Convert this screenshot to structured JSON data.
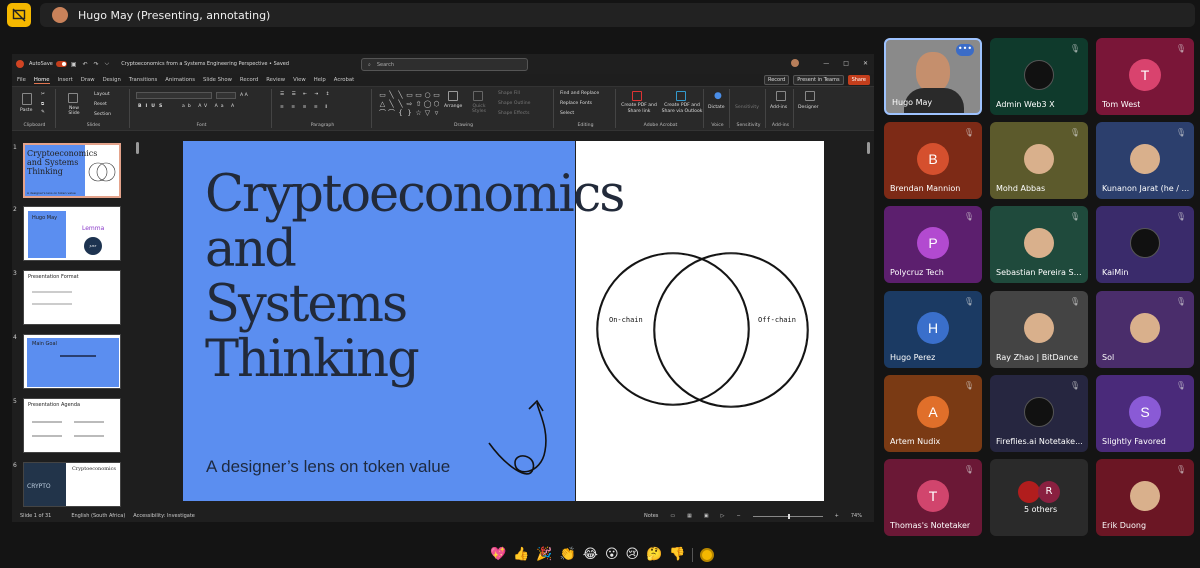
{
  "meeting": {
    "presenter_label": "Hugo May (Presenting, annotating)",
    "reactions": [
      "💖",
      "👍",
      "🎉",
      "👏",
      "😂",
      "😮",
      "😢",
      "🤔",
      "👎"
    ]
  },
  "powerpoint": {
    "autosave": "AutoSave",
    "doc_title": "Cryptoeconomics from a Systems Engineering Perspective • Saved",
    "search_placeholder": "Search",
    "menus": [
      "File",
      "Home",
      "Insert",
      "Draw",
      "Design",
      "Transitions",
      "Animations",
      "Slide Show",
      "Record",
      "Review",
      "View",
      "Help",
      "Acrobat"
    ],
    "active_menu": "Home",
    "record_btn": "Record",
    "present_btn": "Present in Teams",
    "share_btn": "Share",
    "ribbon": {
      "paste": "Paste",
      "new_slide": "New Slide",
      "layout": "Layout",
      "reset": "Reset",
      "section": "Section",
      "arrange": "Arrange",
      "quick_styles": "Quick Styles",
      "shape_fill": "Shape Fill",
      "shape_outline": "Shape Outline",
      "shape_effects": "Shape Effects",
      "find_replace": "Find and Replace",
      "replace_fonts": "Replace Fonts",
      "select": "Select",
      "create_pdf_share": "Create PDF and Share link",
      "create_pdf_outlook": "Create PDF and Share via Outlook",
      "dictate": "Dictate",
      "sensitivity": "Sensitivity",
      "addins": "Add-ins",
      "designer": "Designer",
      "groups": [
        "Clipboard",
        "Slides",
        "Font",
        "Paragraph",
        "Drawing",
        "Editing",
        "Adobe Acrobat",
        "Voice",
        "Sensitivity",
        "Add-ins"
      ]
    },
    "thumbnails": [
      {
        "num": "1",
        "title": "Cryptoeconomics and Systems Thinking",
        "sub": "A designer's lens on token value"
      },
      {
        "num": "2",
        "title": "Hugo May",
        "logo": "Lemma",
        "badge": "JUST"
      },
      {
        "num": "3",
        "title": "Presentation Format"
      },
      {
        "num": "4",
        "title": "Main Goal"
      },
      {
        "num": "5",
        "title": "Presentation Agenda"
      },
      {
        "num": "6",
        "title": "Cryptoeconomics",
        "img": "CRYPTO"
      }
    ],
    "slide": {
      "title": "Cryptoeconomics\nand\nSystems Thinking",
      "subtitle": "A designer’s lens on token value",
      "venn_left": "On-chain",
      "venn_right": "Off-chain"
    },
    "status": {
      "slide_count": "Slide 1 of 31",
      "language": "English (South Africa)",
      "accessibility": "Accessibility: Investigate",
      "notes": "Notes",
      "zoom": "74%"
    }
  },
  "participants": [
    {
      "name": "Hugo May",
      "type": "video",
      "color": "#8a8a8a",
      "col": 0,
      "row": 0,
      "active": true
    },
    {
      "name": "Admin Web3 X",
      "type": "logo",
      "color": "#0f3a2c",
      "col": 1,
      "row": 0
    },
    {
      "name": "Tom West",
      "initial": "T",
      "color": "#7a1638",
      "circle": "#d9436e",
      "col": 2,
      "row": 0
    },
    {
      "name": "Brendan Mannion",
      "initial": "B",
      "color": "#7d2a16",
      "circle": "#d5502e",
      "col": 0,
      "row": 1
    },
    {
      "name": "Mohd Abbas",
      "type": "pic",
      "color": "#5c5a2c",
      "col": 1,
      "row": 1
    },
    {
      "name": "Kunanon Jarat (he / ...",
      "type": "pic",
      "color": "#2c3f6d",
      "col": 2,
      "row": 1
    },
    {
      "name": "Polycruz Tech",
      "initial": "P",
      "color": "#5c1f6e",
      "circle": "#b24ad0",
      "col": 0,
      "row": 2
    },
    {
      "name": "Sebastian Pereira Su...",
      "type": "pic",
      "color": "#1f4a3c",
      "col": 1,
      "row": 2
    },
    {
      "name": "KaiMin",
      "type": "logo",
      "color": "#3a2b6b",
      "col": 2,
      "row": 2
    },
    {
      "name": "Hugo Perez",
      "initial": "H",
      "color": "#1b3a63",
      "circle": "#3a6fcb",
      "col": 0,
      "row": 3
    },
    {
      "name": "Ray Zhao | BitDance",
      "type": "pic",
      "color": "#444",
      "col": 1,
      "row": 3
    },
    {
      "name": "Sol",
      "type": "pic",
      "color": "#4a2d6b",
      "col": 2,
      "row": 3
    },
    {
      "name": "Artem Nudix",
      "initial": "A",
      "color": "#7a3a14",
      "circle": "#e06f2a",
      "col": 0,
      "row": 4
    },
    {
      "name": "Fireflies.ai Notetake...",
      "type": "logo",
      "color": "#262640",
      "col": 1,
      "row": 4
    },
    {
      "name": "Slightly Favored",
      "initial": "S",
      "color": "#4a2a7a",
      "circle": "#8a5ad6",
      "col": 2,
      "row": 4
    },
    {
      "name": "Thomas's Notetaker",
      "initial": "T",
      "color": "#6b1836",
      "circle": "#d1456d",
      "col": 0,
      "row": 5
    },
    {
      "name": "5 others",
      "type": "others",
      "color": "#2a2a2a",
      "col": 1,
      "row": 5
    },
    {
      "name": "Erik Duong",
      "type": "pic",
      "color": "#6b1624",
      "col": 2,
      "row": 5
    }
  ]
}
